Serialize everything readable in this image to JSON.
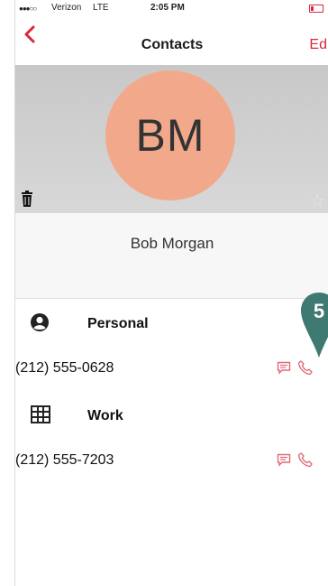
{
  "status_bar": {
    "signal": "●●●○○",
    "carrier": "Verizon",
    "network": "LTE",
    "time": "2:05 PM"
  },
  "nav": {
    "title": "Contacts",
    "edit_label": "Edit"
  },
  "contact": {
    "initials": "BM",
    "name": "Bob Morgan",
    "avatar_color": "#f2a98b"
  },
  "sections": [
    {
      "label": "Personal",
      "icon": "person-circle-icon",
      "phone": "(212) 555-0628"
    },
    {
      "label": "Work",
      "icon": "building-icon",
      "phone": "(212) 555-7203"
    }
  ],
  "annotation": {
    "number": "5",
    "color": "#3f7a72"
  },
  "colors": {
    "accent": "#d9283a"
  }
}
